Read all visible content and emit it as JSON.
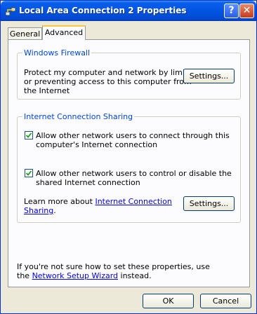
{
  "window": {
    "title": "Local Area Connection 2 Properties",
    "help_label": "?",
    "close_label": "✕"
  },
  "tabs": [
    {
      "label": "General"
    },
    {
      "label": "Advanced"
    }
  ],
  "firewall": {
    "group_label": "Windows Firewall",
    "text_line1": "Protect my computer and network by limiting",
    "text_line2": "or preventing access to this computer from",
    "text_line3": "the Internet",
    "settings_label": "Settings..."
  },
  "ics": {
    "group_label": "Internet Connection Sharing",
    "check1_line1": "Allow other network users to connect through this",
    "check1_line2": "computer's Internet connection",
    "check2_line1": "Allow other network users to control or disable the",
    "check2_line2": "shared Internet connection",
    "learn_prefix": "Learn more about ",
    "learn_link_part1": "Internet Connection",
    "learn_link_part2": "Sharing",
    "learn_suffix": ".",
    "settings_label": "Settings..."
  },
  "footer": {
    "line1": "If you're not sure how to set these properties, use",
    "line2_prefix": "the ",
    "wizard_link": "Network Setup Wizard",
    "line2_suffix": " instead."
  },
  "buttons": {
    "ok": "OK",
    "cancel": "Cancel"
  },
  "colors": {
    "titlebar": "#0054e3",
    "group_label": "#0046d5",
    "link": "#0000ff",
    "tab_highlight": "#ffc83c"
  }
}
